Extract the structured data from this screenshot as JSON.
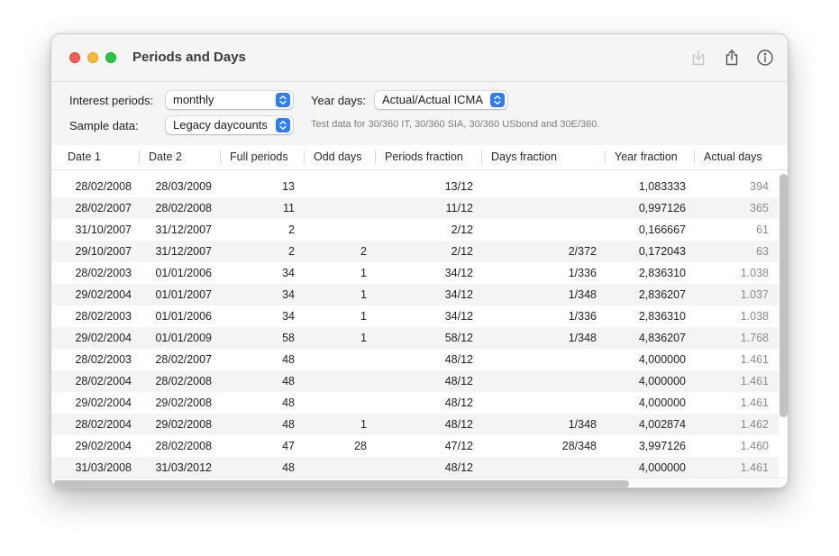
{
  "window": {
    "title": "Periods and Days"
  },
  "toolbar_icons": [
    "download-icon",
    "share-icon",
    "info-icon"
  ],
  "controls": {
    "interest_label": "Interest periods:",
    "interest_value": "monthly",
    "yeardays_label": "Year days:",
    "yeardays_value": "Actual/Actual ICMA",
    "sample_label": "Sample data:",
    "sample_value": "Legacy daycounts",
    "hint": "Test data for 30/360 IT, 30/360 SIA, 30/360 USbond and 30E/360."
  },
  "colors": {
    "accent": "#2f7cf6",
    "row_alt": "#f4f4f4",
    "muted_text": "#8a8a8a"
  },
  "table": {
    "columns": [
      "Date 1",
      "Date 2",
      "Full periods",
      "Odd days",
      "Periods fraction",
      "Days fraction",
      "Year fraction",
      "Actual days"
    ],
    "rows": [
      [
        "28/02/2008",
        "28/03/2009",
        "13",
        "",
        "13/12",
        "",
        "1,083333",
        "394"
      ],
      [
        "28/02/2007",
        "28/02/2008",
        "11",
        "",
        "11/12",
        "",
        "0,997126",
        "365"
      ],
      [
        "31/10/2007",
        "31/12/2007",
        "2",
        "",
        "2/12",
        "",
        "0,166667",
        "61"
      ],
      [
        "29/10/2007",
        "31/12/2007",
        "2",
        "2",
        "2/12",
        "2/372",
        "0,172043",
        "63"
      ],
      [
        "28/02/2003",
        "01/01/2006",
        "34",
        "1",
        "34/12",
        "1/336",
        "2,836310",
        "1.038"
      ],
      [
        "29/02/2004",
        "01/01/2007",
        "34",
        "1",
        "34/12",
        "1/348",
        "2,836207",
        "1.037"
      ],
      [
        "28/02/2003",
        "01/01/2006",
        "34",
        "1",
        "34/12",
        "1/336",
        "2,836310",
        "1.038"
      ],
      [
        "29/02/2004",
        "01/01/2009",
        "58",
        "1",
        "58/12",
        "1/348",
        "4,836207",
        "1.768"
      ],
      [
        "28/02/2003",
        "28/02/2007",
        "48",
        "",
        "48/12",
        "",
        "4,000000",
        "1.461"
      ],
      [
        "28/02/2004",
        "28/02/2008",
        "48",
        "",
        "48/12",
        "",
        "4,000000",
        "1.461"
      ],
      [
        "29/02/2004",
        "29/02/2008",
        "48",
        "",
        "48/12",
        "",
        "4,000000",
        "1.461"
      ],
      [
        "28/02/2004",
        "29/02/2008",
        "48",
        "1",
        "48/12",
        "1/348",
        "4,002874",
        "1.462"
      ],
      [
        "29/02/2004",
        "28/02/2008",
        "47",
        "28",
        "47/12",
        "28/348",
        "3,997126",
        "1.460"
      ],
      [
        "31/03/2008",
        "31/03/2012",
        "48",
        "",
        "48/12",
        "",
        "4,000000",
        "1.461"
      ]
    ]
  }
}
